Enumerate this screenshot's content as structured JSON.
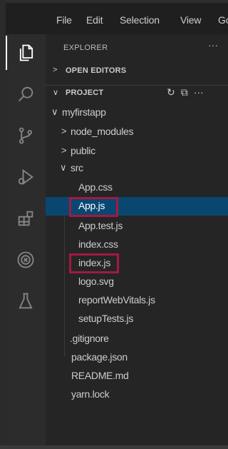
{
  "menubar": {
    "items": [
      "File",
      "Edit",
      "Selection",
      "View",
      "Go"
    ]
  },
  "activity_bar": {
    "items": [
      {
        "icon": "files-icon",
        "active": true
      },
      {
        "icon": "search-icon",
        "active": false
      },
      {
        "icon": "source-control-icon",
        "active": false
      },
      {
        "icon": "run-debug-icon",
        "active": false
      },
      {
        "icon": "extensions-icon",
        "active": false
      },
      {
        "icon": "remote-explorer-icon",
        "active": false
      },
      {
        "icon": "testing-icon",
        "active": false
      }
    ]
  },
  "sidebar": {
    "title": "EXPLORER",
    "more_icon": "···",
    "open_editors": {
      "label": "OPEN EDITORS",
      "chevron": ">"
    },
    "project": {
      "label": "PROJECT",
      "chevron": "∨",
      "actions": [
        "↻",
        "⧉",
        "···"
      ]
    },
    "tree": [
      {
        "label": "myfirstapp",
        "chevron": "∨",
        "depth": 0
      },
      {
        "label": "node_modules",
        "chevron": ">",
        "depth": 1
      },
      {
        "label": "public",
        "chevron": ">",
        "depth": 1
      },
      {
        "label": "src",
        "chevron": "∨",
        "depth": 1
      },
      {
        "label": "App.css",
        "depth": 2
      },
      {
        "label": "App.js",
        "depth": 2,
        "selected": true,
        "highlighted": true
      },
      {
        "label": "App.test.js",
        "depth": 2
      },
      {
        "label": "index.css",
        "depth": 2
      },
      {
        "label": "index.js",
        "depth": 2,
        "highlighted": true
      },
      {
        "label": "logo.svg",
        "depth": 2
      },
      {
        "label": "reportWebVitals.js",
        "depth": 2
      },
      {
        "label": "setupTests.js",
        "depth": 2
      },
      {
        "label": ".gitignore",
        "depth": 1
      },
      {
        "label": "package.json",
        "depth": 1
      },
      {
        "label": "README.md",
        "depth": 1
      },
      {
        "label": "yarn.lock",
        "depth": 1
      }
    ]
  },
  "colors": {
    "selection": "#094771",
    "annotation": "#a3193f"
  }
}
